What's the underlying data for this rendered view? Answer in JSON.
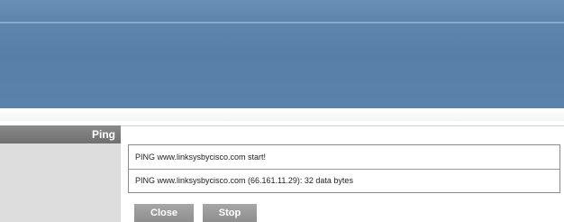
{
  "sidebar": {
    "section_label": "Ping"
  },
  "ping_log": {
    "lines": [
      "PING www.linksysbycisco.com start!",
      "PING www.linksysbycisco.com (66.161.11.29): 32 data bytes"
    ]
  },
  "buttons": {
    "close_label": "Close",
    "stop_label": "Stop"
  },
  "colors": {
    "banner": "#5a82aa",
    "sidebar_header": "#7b7b7b",
    "sidebar": "#dddddd",
    "button": "#9a9a9a"
  }
}
